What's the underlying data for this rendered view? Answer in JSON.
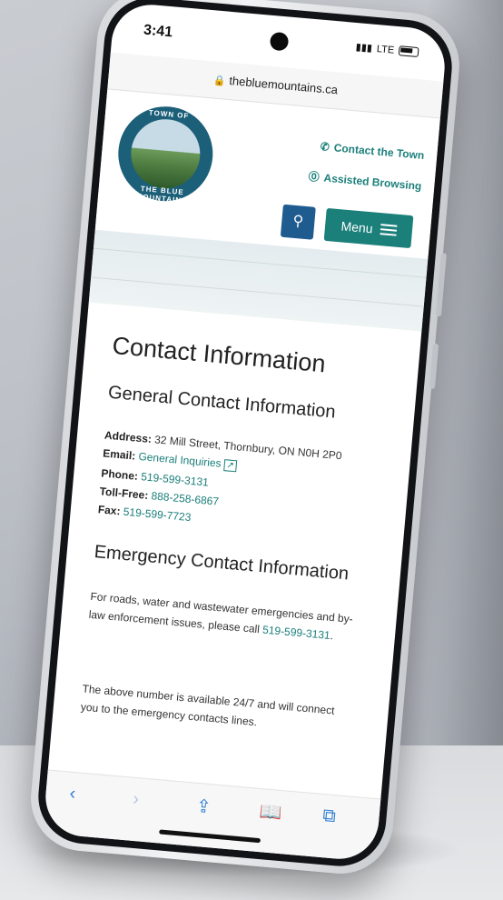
{
  "status_bar": {
    "time": "3:41",
    "network": "LTE"
  },
  "browser": {
    "url": "thebluemountains.ca"
  },
  "header": {
    "logo_top_text": "TOWN OF",
    "logo_bottom_text": "THE BLUE MOUNTAINS",
    "contact_link": "Contact the Town",
    "assisted_link": "Assisted Browsing",
    "menu_label": "Menu"
  },
  "content": {
    "page_title": "Contact Information",
    "general_heading": "General Contact Information",
    "address_label": "Address:",
    "address_value": "32 Mill Street, Thornbury, ON N0H 2P0",
    "email_label": "Email:",
    "email_value": "General Inquiries",
    "phone_label": "Phone:",
    "phone_value": "519-599-3131",
    "tollfree_label": "Toll-Free:",
    "tollfree_value": "888-258-6867",
    "fax_label": "Fax:",
    "fax_value": "519-599-7723",
    "emergency_heading": "Emergency Contact Information",
    "emergency_text": "For roads, water and wastewater emergencies and by-law enforcement issues, please call",
    "emergency_number": "519-599-3131",
    "availability_text": "The above number is available 24/7 and will connect you to the emergency contacts lines."
  },
  "icons": {
    "lock": "lock-icon",
    "phone": "phone-icon",
    "accessibility": "accessibility-icon",
    "search": "search-icon",
    "menu": "hamburger-icon",
    "back": "chevron-left-icon",
    "forward": "chevron-right-icon",
    "share": "share-icon",
    "bookmarks": "book-icon",
    "tabs": "tabs-icon"
  },
  "colors": {
    "teal": "#1b7f7a",
    "navy": "#1e5b8f",
    "text": "#222222"
  }
}
